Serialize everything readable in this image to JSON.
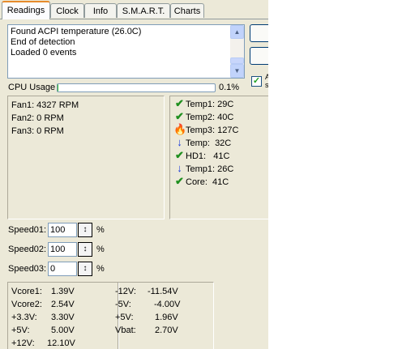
{
  "tabs": [
    {
      "label": "Readings",
      "active": true
    },
    {
      "label": "Clock"
    },
    {
      "label": "Info"
    },
    {
      "label": "S.M.A.R.T."
    },
    {
      "label": "Charts"
    }
  ],
  "log": {
    "lines": [
      "Found ACPI temperature (26.0C)",
      "End of detection",
      "Loaded 0 events"
    ]
  },
  "side": {
    "checkbox_fragment": "A",
    "checkbox_fragment2": "s"
  },
  "cpu": {
    "label": "CPU Usage",
    "value_text": "0.1%",
    "percent": 0.1
  },
  "fans": [
    "Fan1: 4327 RPM",
    "Fan2: 0 RPM",
    "Fan3: 0 RPM"
  ],
  "temps": [
    {
      "icon": "check-icon",
      "label": "Temp1: 29C"
    },
    {
      "icon": "check-icon",
      "label": "Temp2: 40C"
    },
    {
      "icon": "flame-icon",
      "label": "Temp3: 127C"
    },
    {
      "icon": "down-arrow-icon",
      "label": "Temp:  32C"
    },
    {
      "icon": "check-icon",
      "label": "HD1:   41C"
    },
    {
      "icon": "down-arrow-icon",
      "label": "Temp1: 26C"
    },
    {
      "icon": "check-icon",
      "label": "Core:  41C"
    }
  ],
  "speeds": [
    {
      "label": "Speed01:",
      "value": "100",
      "unit": "%"
    },
    {
      "label": "Speed02:",
      "value": "100",
      "unit": "%"
    },
    {
      "label": "Speed03:",
      "value": "0",
      "unit": "%"
    }
  ],
  "voltages_left": [
    {
      "name": "Vcore1:",
      "value": "1.39V"
    },
    {
      "name": "Vcore2:",
      "value": "2.54V"
    },
    {
      "name": "+3.3V:",
      "value": "3.30V"
    },
    {
      "name": "+5V:",
      "value": "5.00V"
    },
    {
      "name": "+12V:",
      "value": "12.10V"
    }
  ],
  "voltages_right": [
    {
      "name": "-12V:",
      "value": "-11.54V"
    },
    {
      "name": "-5V:",
      "value": "-4.00V"
    },
    {
      "name": "+5V:",
      "value": "1.96V"
    },
    {
      "name": "Vbat:",
      "value": "2.70V"
    }
  ],
  "colors": {
    "accent_tab": "#e68b2c",
    "progress": "#2fbb2f",
    "ok": "#1f8f1f",
    "down": "#1a3bd9",
    "hot": "#ff4a00"
  }
}
